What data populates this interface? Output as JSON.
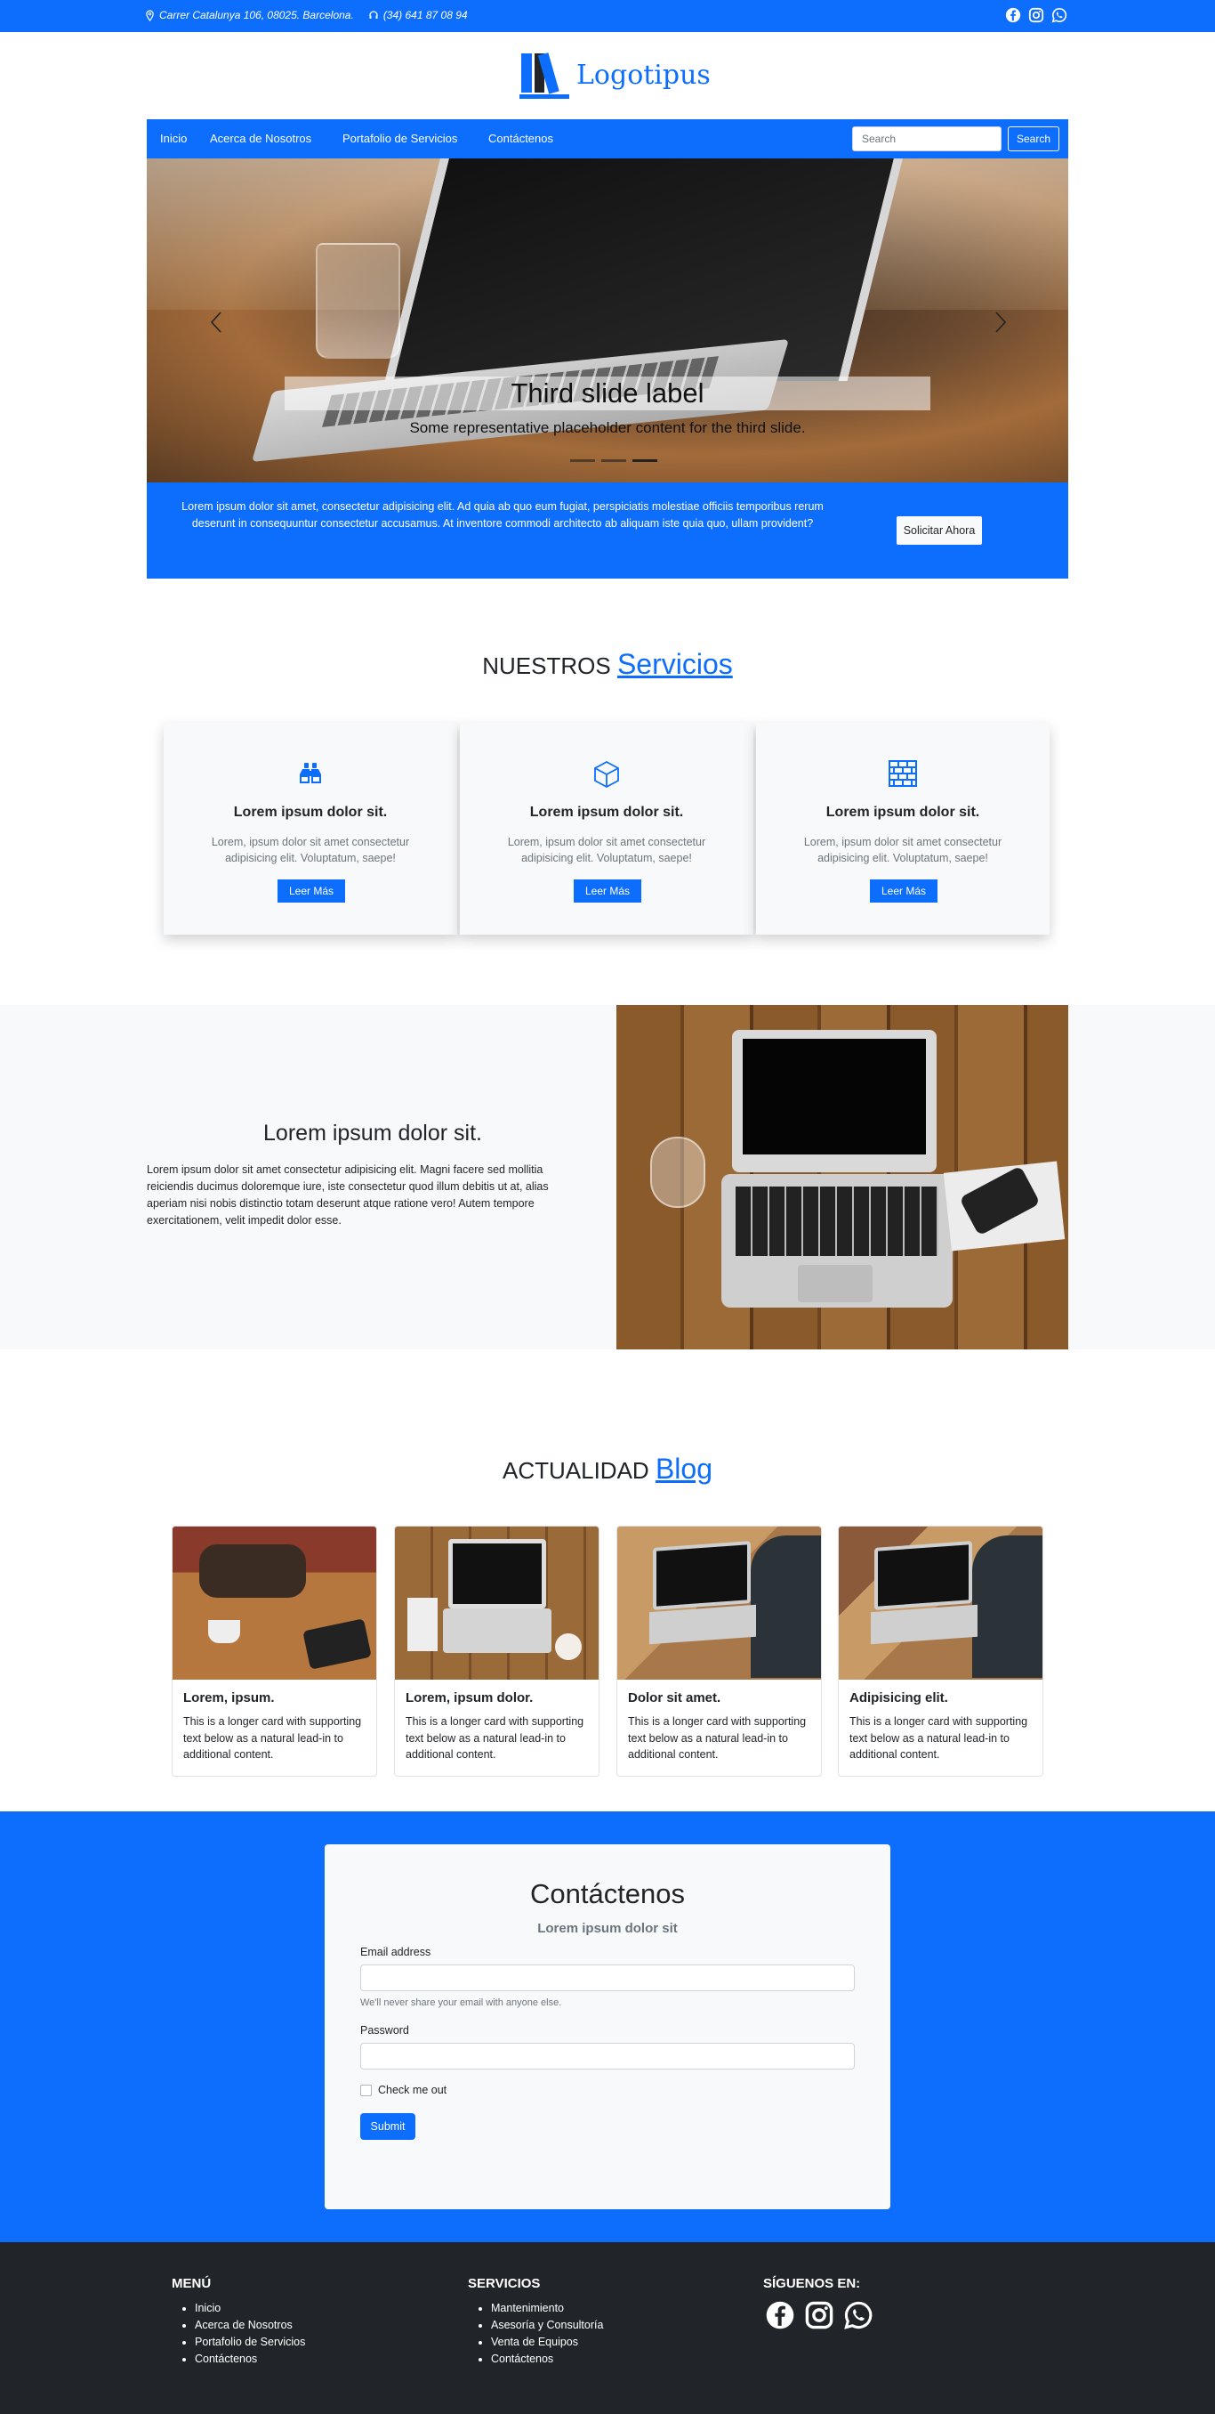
{
  "topbar": {
    "address": "Carrer Catalunya 106, 08025. Barcelona.",
    "phone": "(34) 641 87 08 94",
    "social_icons": [
      "facebook-icon",
      "instagram-icon",
      "whatsapp-icon"
    ]
  },
  "brand": {
    "name": "Logotipus",
    "color": "#0d6efd"
  },
  "nav": {
    "items": [
      "Inicio",
      "Acerca de Nosotros",
      "Portafolio de Servicios",
      "Contáctenos"
    ],
    "search_placeholder": "Search",
    "search_button": "Search"
  },
  "carousel": {
    "title": "Third slide label",
    "subtitle": "Some representative placeholder content for the third slide.",
    "prev_icon": "chevron-left-icon",
    "next_icon": "chevron-right-icon",
    "indicators": 3,
    "active_indicator": 3
  },
  "promo": {
    "text": "Lorem ipsum dolor sit amet, consectetur adipisicing elit. Ad quia ab quo eum fugiat, perspiciatis molestiae officiis temporibus rerum deserunt in consequuntur consectetur accusamus. At inventore commodi architecto ab aliquam iste quia quo, ullam provident?",
    "button": "Solicitar Ahora"
  },
  "services": {
    "heading_prefix": "NUESTROS",
    "heading_highlight": "Servicios",
    "cards": [
      {
        "icon": "binoculars-icon",
        "title": "Lorem ipsum dolor sit.",
        "text": "Lorem, ipsum dolor sit amet consectetur adipisicing elit. Voluptatum, saepe!",
        "button": "Leer Más"
      },
      {
        "icon": "box-icon",
        "title": "Lorem ipsum dolor sit.",
        "text": "Lorem, ipsum dolor sit amet consectetur adipisicing elit. Voluptatum, saepe!",
        "button": "Leer Más"
      },
      {
        "icon": "bricks-icon",
        "title": "Lorem ipsum dolor sit.",
        "text": "Lorem, ipsum dolor sit amet consectetur adipisicing elit. Voluptatum, saepe!",
        "button": "Leer Más"
      }
    ]
  },
  "about": {
    "title": "Lorem ipsum dolor sit.",
    "text": "Lorem ipsum dolor sit amet consectetur adipisicing elit. Magni facere sed mollitia reiciendis ducimus doloremque iure, iste consectetur quod illum debitis ut at, alias aperiam nisi nobis distinctio totam deserunt atque ratione vero! Autem tempore exercitationem, velit impedit dolor esse."
  },
  "blog": {
    "heading_prefix": "ACTUALIDAD",
    "heading_highlight": "Blog",
    "cards": [
      {
        "title": "Lorem, ipsum.",
        "text": "This is a longer card with supporting text below as a natural lead-in to additional content."
      },
      {
        "title": "Lorem, ipsum dolor.",
        "text": "This is a longer card with supporting text below as a natural lead-in to additional content."
      },
      {
        "title": "Dolor sit amet.",
        "text": "This is a longer card with supporting text below as a natural lead-in to additional content."
      },
      {
        "title": "Adipisicing elit.",
        "text": "This is a longer card with supporting text below as a natural lead-in to additional content."
      }
    ]
  },
  "contact": {
    "title": "Contáctenos",
    "subtitle": "Lorem ipsum dolor sit",
    "email_label": "Email address",
    "email_hint": "We'll never share your email with anyone else.",
    "password_label": "Password",
    "checkbox_label": "Check me out",
    "submit": "Submit"
  },
  "footer": {
    "menu_title": "MENÚ",
    "menu_items": [
      "Inicio",
      "Acerca de Nosotros",
      "Portafolio de Servicios",
      "Contáctenos"
    ],
    "services_title": "SERVICIOS",
    "services_items": [
      "Mantenimiento",
      "Asesoría y Consultoría",
      "Venta de Equipos",
      "Contáctenos"
    ],
    "social_title": "SÍGUENOS EN:",
    "social_icons": [
      "facebook-icon",
      "instagram-icon",
      "whatsapp-icon"
    ]
  }
}
